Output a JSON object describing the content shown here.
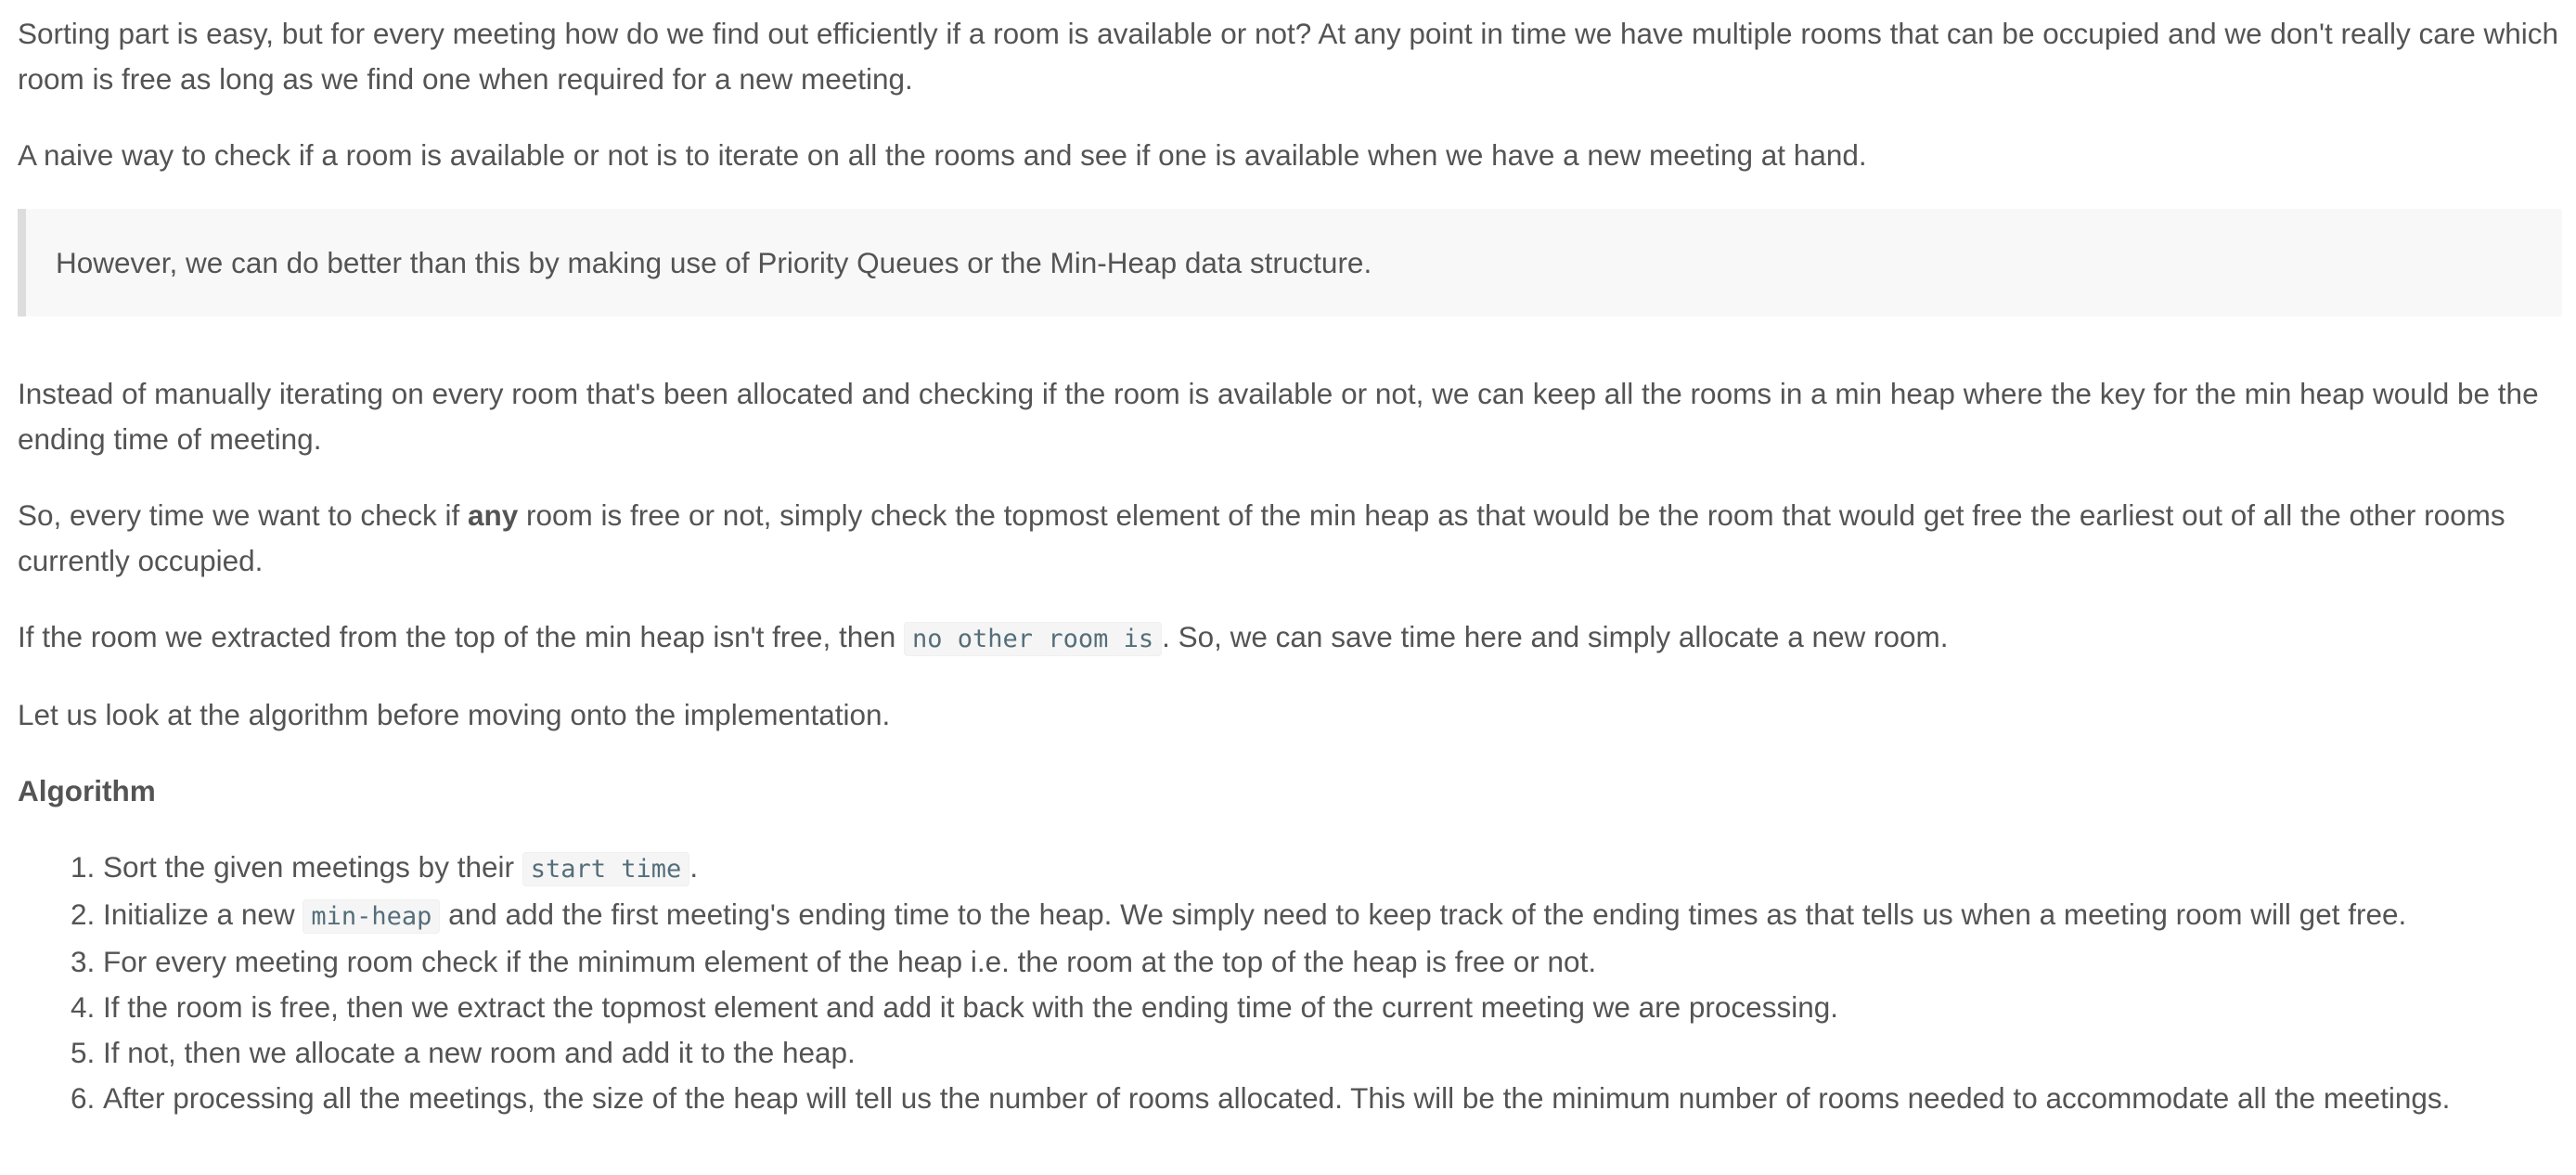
{
  "paragraphs": {
    "p1": "Sorting part is easy, but for every meeting how do we find out efficiently if a room is available or not? At any point in time we have multiple rooms that can be occupied and we don't really care which room is free as long as we find one when required for a new meeting.",
    "p2": "A naive way to check if a room is available or not is to iterate on all the rooms and see if one is available when we have a new meeting at hand.",
    "quote": "However, we can do better than this by making use of Priority Queues or the Min-Heap data structure.",
    "p3": "Instead of manually iterating on every room that's been allocated and checking if the room is available or not, we can keep all the rooms in a min heap where the key for the min heap would be the ending time of meeting.",
    "p4_pre": "So, every time we want to check if ",
    "p4_bold": "any",
    "p4_post": " room is free or not, simply check the topmost element of the min heap as that would be the room that would get free the earliest out of all the other rooms currently occupied.",
    "p5_pre": "If the room we extracted from the top of the min heap isn't free, then ",
    "p5_code": "no other room is",
    "p5_post": ". So, we can save time here and simply allocate a new room.",
    "p6": "Let us look at the algorithm before moving onto the implementation."
  },
  "algorithm": {
    "heading": "Algorithm",
    "steps": {
      "s1_pre": "Sort the given meetings by their ",
      "s1_code": "start time",
      "s1_post": ".",
      "s2_pre": "Initialize a new ",
      "s2_code": "min-heap",
      "s2_post": " and add the first meeting's ending time to the heap. We simply need to keep track of the ending times as that tells us when a meeting room will get free.",
      "s3": "For every meeting room check if the minimum element of the heap i.e. the room at the top of the heap is free or not.",
      "s4": "If the room is free, then we extract the topmost element and add it back with the ending time of the current meeting we are processing.",
      "s5": "If not, then we allocate a new room and add it to the heap.",
      "s6": "After processing all the meetings, the size of the heap will tell us the number of rooms allocated. This will be the minimum number of rooms needed to accommodate all the meetings."
    }
  }
}
